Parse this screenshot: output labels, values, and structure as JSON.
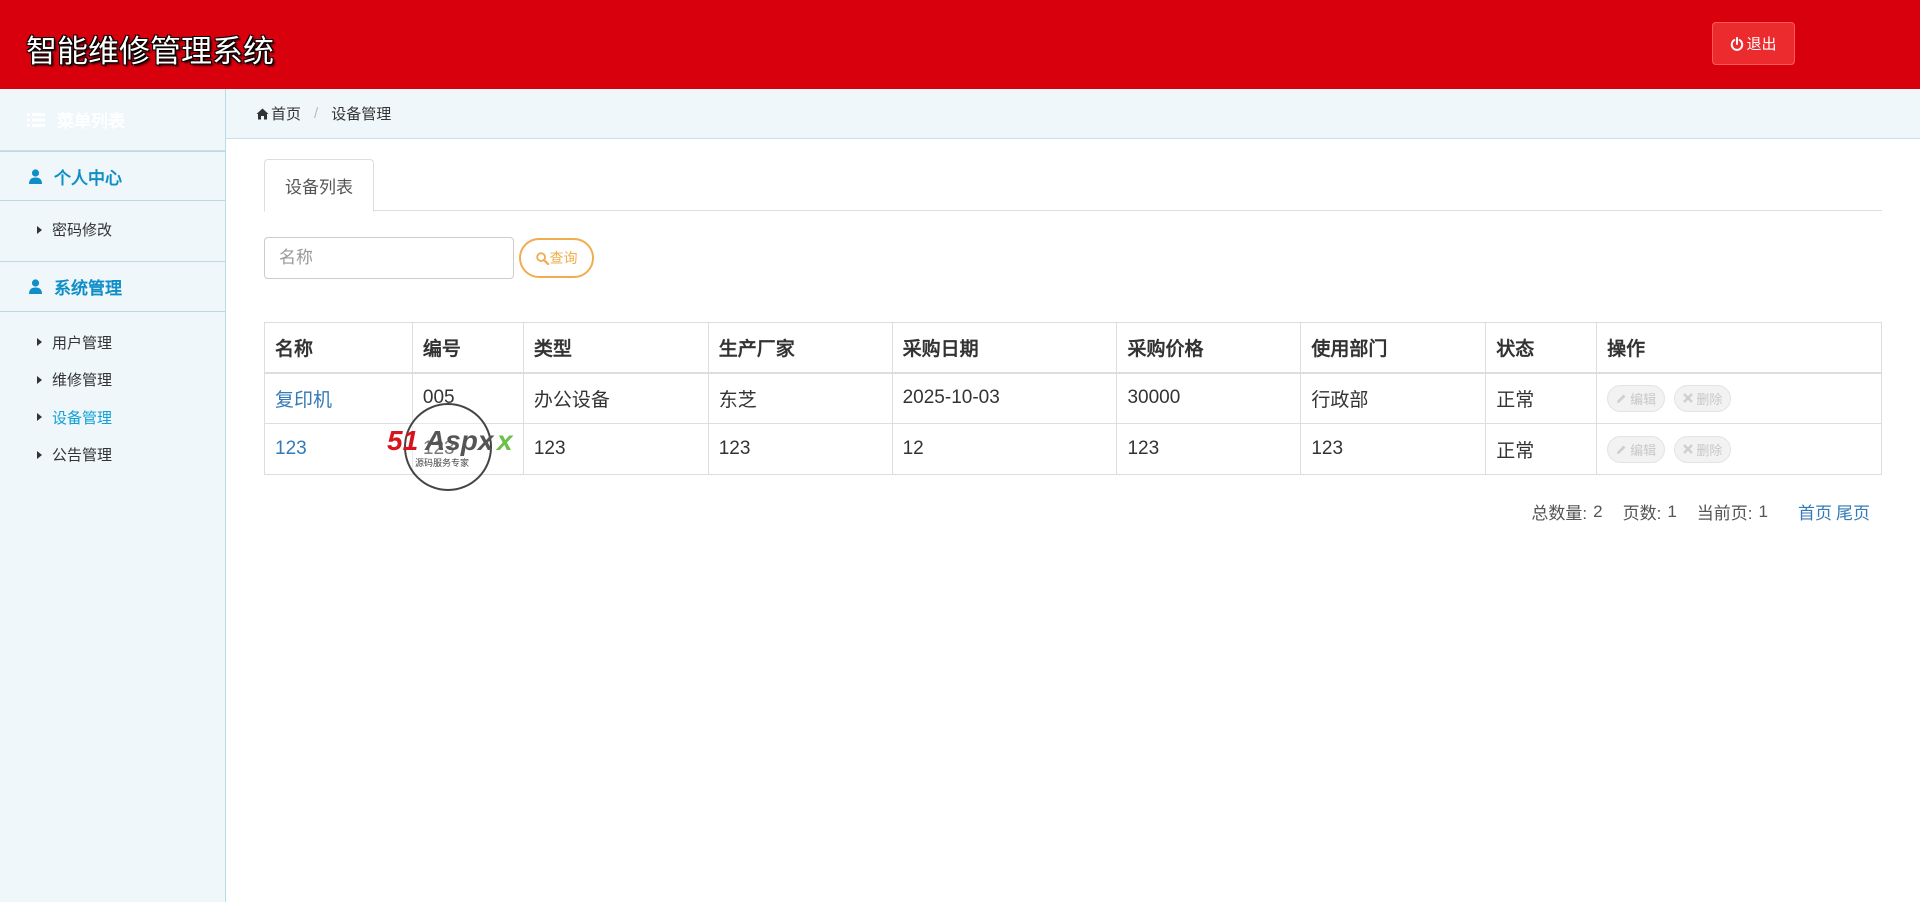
{
  "header": {
    "title": "智能维修管理系统",
    "logout_label": "退出",
    "bg_color": "#d9000e"
  },
  "sidebar": {
    "heading": "菜单列表",
    "groups": [
      {
        "label": "个人中心",
        "icon": "user-icon",
        "items": [
          {
            "label": "密码修改"
          }
        ]
      },
      {
        "label": "系统管理",
        "icon": "user-icon",
        "items": [
          {
            "label": "用户管理"
          },
          {
            "label": "维修管理"
          },
          {
            "label": "设备管理",
            "active": true
          },
          {
            "label": "公告管理"
          }
        ]
      }
    ]
  },
  "breadcrumb": {
    "home": "首页",
    "current": "设备管理"
  },
  "main": {
    "tab_label": "设备列表",
    "search": {
      "placeholder": "名称",
      "value": ""
    },
    "query_label": "查询",
    "table": {
      "headers": [
        "名称",
        "编号",
        "类型",
        "生产厂家",
        "采购日期",
        "采购价格",
        "使用部门",
        "状态",
        "操作"
      ],
      "rows": [
        {
          "name": "复印机",
          "code": "005",
          "type": "办公设备",
          "maker": "东芝",
          "date": "2025-10-03",
          "price": "30000",
          "dept": "行政部",
          "status": "正常"
        },
        {
          "name": "123",
          "code": "123",
          "type": "123",
          "maker": "123",
          "date": "12",
          "price": "123",
          "dept": "123",
          "status": "正常"
        }
      ],
      "edit_label": "编辑",
      "delete_label": "删除"
    },
    "pager": {
      "total_label": "总数量:",
      "total": "2",
      "pages_label": "页数:",
      "pages": "1",
      "current_label": "当前页:",
      "current": "1",
      "first": "首页",
      "last": "尾页"
    }
  },
  "watermark": {
    "brand": "51Aspx",
    "tagline": "源码服务专家"
  }
}
